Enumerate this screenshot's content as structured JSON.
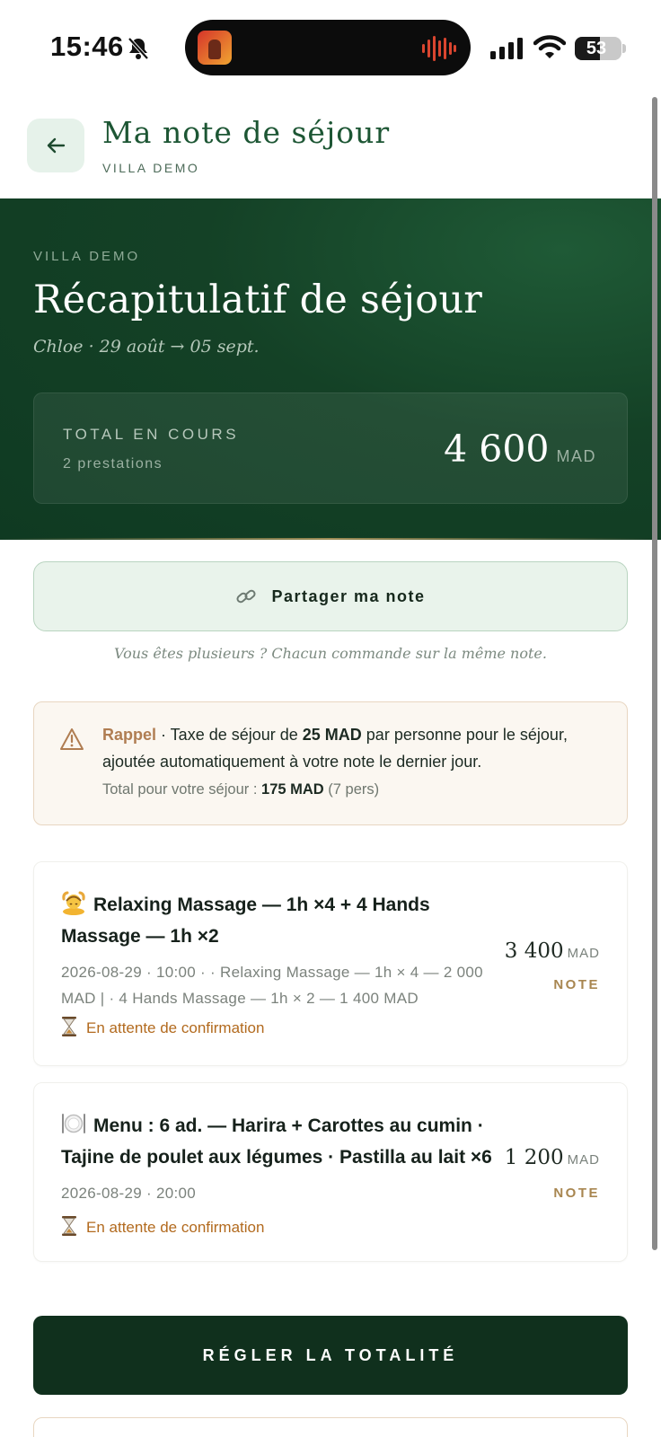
{
  "status_bar": {
    "time": "15:46",
    "battery": "53",
    "battery_level": 0.53
  },
  "header": {
    "title": "Ma note de séjour",
    "subtitle": "VILLA DEMO",
    "back_icon": "arrow-left-icon"
  },
  "hero": {
    "label": "VILLA DEMO",
    "title": "Récapitulatif de séjour",
    "guest_dates": "Chloe · 29 août → 05 sept.",
    "total_label": "TOTAL EN COURS",
    "total_count": "2 prestations",
    "total_value": "4 600",
    "total_currency": "MAD"
  },
  "share": {
    "label": "Partager ma note",
    "icon": "link-icon",
    "note": "Vous êtes plusieurs ? Chacun commande sur la même note."
  },
  "reminder": {
    "icon": "warning-icon",
    "title": "Rappel",
    "text_a": " · Taxe de séjour de ",
    "amount": "25 MAD",
    "text_b": " par personne pour le séjour,",
    "line2": "ajoutée automatiquement à votre note le dernier jour.",
    "total_label": "Total pour votre séjour : ",
    "total_value": "175 MAD",
    "total_persons": " (7 pers)"
  },
  "orders": [
    {
      "icon": "massage-icon",
      "title": "Relaxing Massage — 1h ×4 + 4 Hands Massage — 1h ×2",
      "meta": "2026-08-29 · 10:00 · · Relaxing Massage — 1h × 4 — 2 000 MAD | · 4 Hands Massage — 1h × 2 — 1 400 MAD",
      "status": "En attente de confirmation",
      "status_icon": "hourglass-icon",
      "price": "3 400",
      "currency": "MAD",
      "tag": "NOTE"
    },
    {
      "icon": "plate-icon",
      "title": "Menu : 6 ad. — Harira + Carottes au cumin · Tajine de poulet aux légumes · Pastilla au lait ×6",
      "meta": "2026-08-29 · 20:00",
      "status": "En attente de confirmation",
      "status_icon": "hourglass-icon",
      "price": "1 200",
      "currency": "MAD",
      "tag": "NOTE"
    }
  ],
  "pay": {
    "label": "RÉGLER LA TOTALITÉ"
  },
  "colors": {
    "brand_green": "#144126",
    "accent_gold": "#b07d52",
    "pending": "#b26a1e"
  }
}
